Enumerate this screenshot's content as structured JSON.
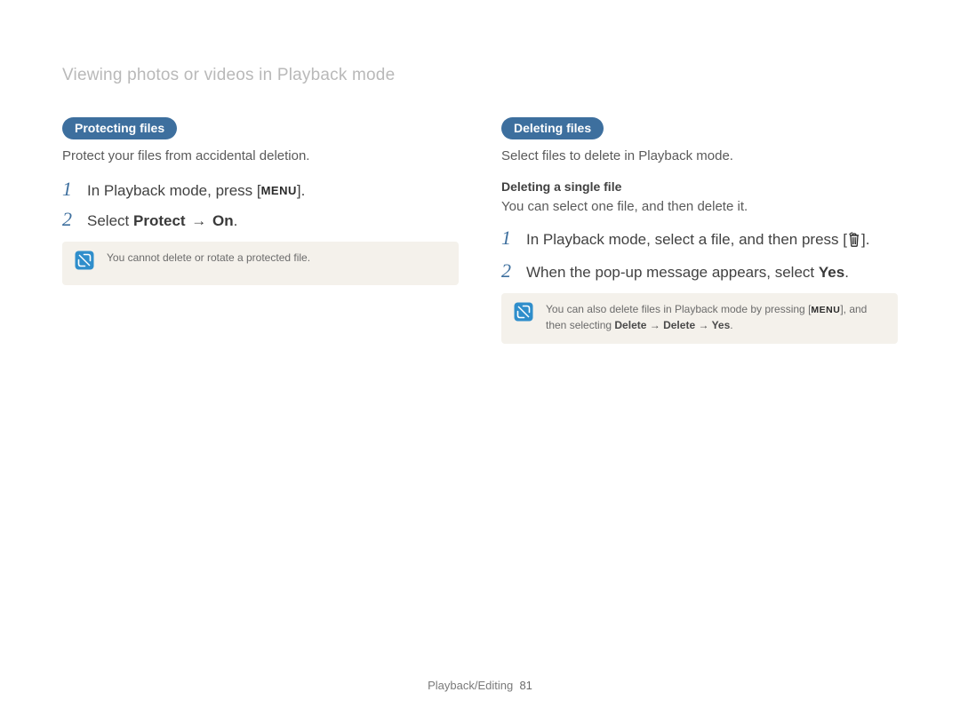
{
  "header": {
    "title": "Viewing photos or videos in Playback mode"
  },
  "left": {
    "pill": "Protecting files",
    "lead": "Protect your files from accidental deletion.",
    "steps": [
      {
        "num": "1",
        "pre": "In Playback mode, press [",
        "glyph": "MENU",
        "post": "]."
      },
      {
        "num": "2",
        "pre": "Select ",
        "bold1": "Protect",
        "arrow": " → ",
        "bold2": "On",
        "post": "."
      }
    ],
    "note": "You cannot delete or rotate a protected file."
  },
  "right": {
    "pill": "Deleting files",
    "lead": "Select files to delete in Playback mode.",
    "subhead": "Deleting a single file",
    "subtext": "You can select one file, and then delete it.",
    "steps": [
      {
        "num": "1",
        "pre": "In Playback mode, select a file, and then press [",
        "icon": "trash",
        "post": "]."
      },
      {
        "num": "2",
        "pre": "When the pop-up message appears, select ",
        "bold1": "Yes",
        "post": "."
      }
    ],
    "note_pre": "You can also delete files in Playback mode by pressing [",
    "note_glyph": "MENU",
    "note_mid": "], and then selecting ",
    "note_b1": "Delete",
    "note_arrow1": " → ",
    "note_b2": "Delete",
    "note_arrow2": " → ",
    "note_b3": "Yes",
    "note_post": "."
  },
  "footer": {
    "section": "Playback/Editing",
    "page": "81"
  }
}
